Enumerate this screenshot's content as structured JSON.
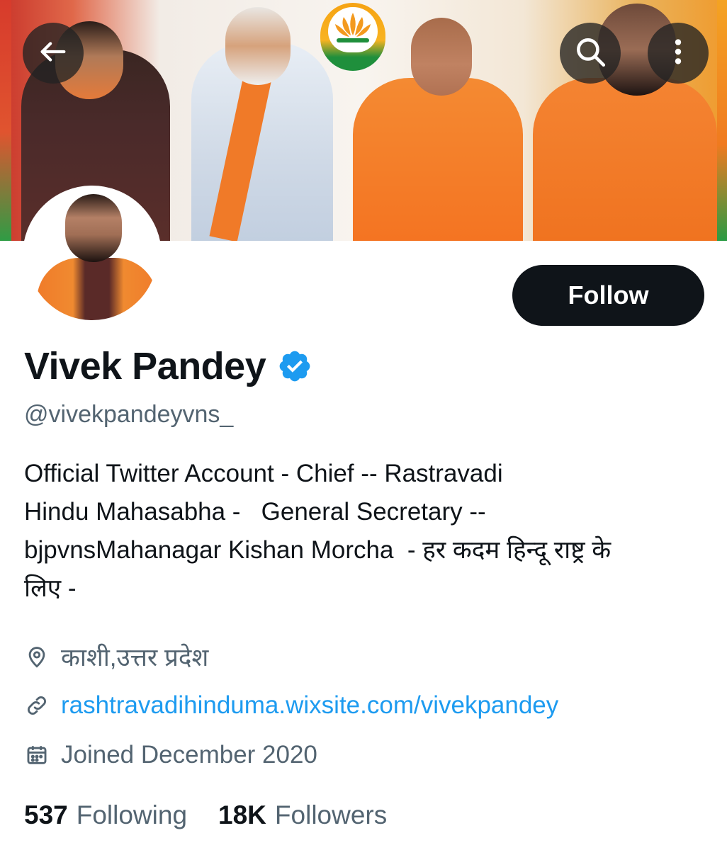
{
  "header": {
    "back_icon": "arrow-left-icon",
    "search_icon": "search-icon",
    "more_icon": "more-vertical-icon"
  },
  "profile": {
    "name": "Vivek Pandey",
    "verified_icon": "verified-badge-icon",
    "handle": "@vivekpandeyvns_",
    "follow_label": "Follow",
    "bio_lines": [
      "Official Twitter Account - Chief -- Rastravadi",
      "Hindu Mahasabha -   General Secretary --",
      "bjpvnsMahanagar Kishan Morcha  - हर कदम हिन्दू राष्ट्र के",
      "लिए -"
    ],
    "location": "काशी,उत्तर प्रदेश",
    "website": "rashtravadihinduma.wixsite.com/vivekpandey",
    "joined": "Joined December 2020",
    "following_count": "537",
    "following_label": "Following",
    "followers_count": "18K",
    "followers_label": "Followers"
  },
  "colors": {
    "text_primary": "#0f1419",
    "text_secondary": "#536471",
    "link": "#1d9bf0",
    "follow_bg": "#0f1419"
  }
}
